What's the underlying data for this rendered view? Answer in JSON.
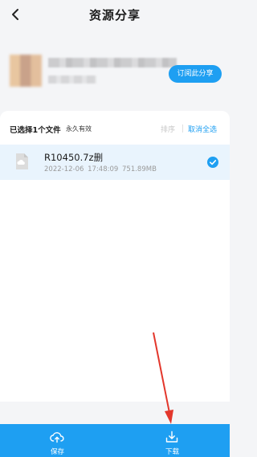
{
  "header": {
    "title": "资源分享"
  },
  "sharer": {
    "subscribe_label": "订阅此分享"
  },
  "selection_bar": {
    "selected_text": "已选择1个文件",
    "validity_text": "永久有效",
    "sort_label": "排序",
    "cancel_all_label": "取消全选"
  },
  "files": [
    {
      "name": "R10450.7z删",
      "date": "2022-12-06",
      "time": "17:48:09",
      "size": "751.89MB",
      "selected": true
    }
  ],
  "bottom_bar": {
    "save_label": "保存",
    "download_label": "下载"
  },
  "colors": {
    "accent": "#1e9ff2",
    "annotation_arrow": "#e3372c",
    "selected_row": "#e9f4fd"
  },
  "icons": [
    "back-icon",
    "file-icon",
    "check-icon",
    "cloud-upload-icon",
    "download-icon"
  ]
}
